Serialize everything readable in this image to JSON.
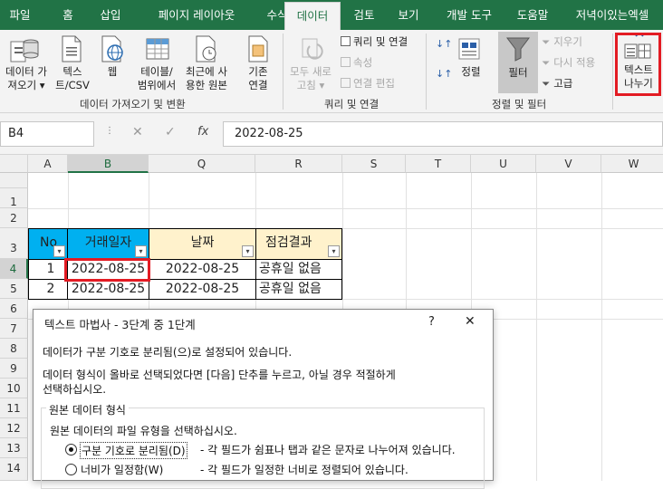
{
  "tabs": [
    "파일",
    "홈",
    "삽입",
    "페이지 레이아웃",
    "수식",
    "데이터",
    "검토",
    "보기",
    "개발 도구",
    "도움말",
    "저녁이있는엑셀"
  ],
  "ribbon": {
    "get_data": [
      "데이터 가",
      "져오기 ▾"
    ],
    "text_csv": [
      "텍스",
      "트/CSV"
    ],
    "web": [
      "웹"
    ],
    "table_range": [
      "테이블/",
      "범위에서"
    ],
    "recent": [
      "최근에 사",
      "용한 원본"
    ],
    "existing": [
      "기존",
      "연결"
    ],
    "group1_label": "데이터 가져오기 및 변환",
    "refresh_all": [
      "모두 새로",
      "고침 ▾"
    ],
    "queries_conn": "쿼리 및 연결",
    "properties": "속성",
    "edit_links": "연결 편집",
    "group2_label": "쿼리 및 연결",
    "sort_label": "정렬",
    "filter_label": "필터",
    "clear": "지우기",
    "reapply": "다시 적용",
    "advanced": "고급",
    "group3_label": "정렬 및 필터",
    "text_to_columns": [
      "텍스트",
      "나누기"
    ]
  },
  "formula_bar": {
    "name_box": "B4",
    "fx": "fx",
    "value": "2022-08-25"
  },
  "columns": [
    "A",
    "B",
    "Q",
    "R",
    "S",
    "T",
    "U",
    "V",
    "W"
  ],
  "rows": [
    "1",
    "2",
    "3",
    "4",
    "5",
    "6",
    "7",
    "8",
    "9",
    "10",
    "11",
    "12",
    "13",
    "14"
  ],
  "table": {
    "headers": [
      "No",
      "거래일자",
      "날짜",
      "점검결과"
    ],
    "rows": [
      [
        "1",
        "2022-08-25",
        "2022-08-25",
        "공휴일 없음"
      ],
      [
        "2",
        "2022-08-25",
        "2022-08-25",
        "공휴일 없음"
      ]
    ]
  },
  "dialog": {
    "title": "텍스트 마법사 - 3단계 중 1단계",
    "help": "?",
    "close": "✕",
    "line1": "데이터가 구분 기호로 분리됨(으)로 설정되어 있습니다.",
    "line2": "데이터 형식이 올바로 선택되었다면 [다음] 단추를 누르고, 아닐 경우 적절하게",
    "line3": "선택하십시오.",
    "section": "원본 데이터 형식",
    "prompt": "원본 데이터의 파일 유형을 선택하십시오.",
    "opt1_label": "구분 기호로 분리됨(D)",
    "opt1_desc": "- 각 필드가 쉼표나 탭과 같은 문자로 나누어져 있습니다.",
    "opt2_label": "너비가 일정함(W)",
    "opt2_desc": "- 각 필드가 일정한 너비로 정렬되어 있습니다."
  }
}
